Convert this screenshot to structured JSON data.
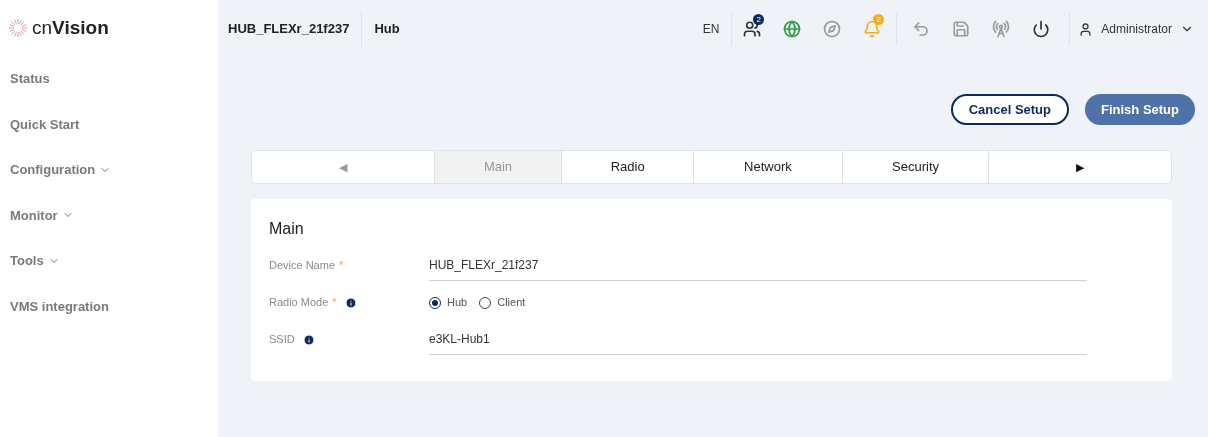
{
  "logo": {
    "text": "cn**Vision**"
  },
  "sidebar": {
    "items": [
      {
        "label": "Status",
        "expandable": false
      },
      {
        "label": "Quick Start",
        "expandable": false
      },
      {
        "label": "Configuration",
        "expandable": true
      },
      {
        "label": "Monitor",
        "expandable": true
      },
      {
        "label": "Tools",
        "expandable": true
      },
      {
        "label": "VMS integration",
        "expandable": false
      }
    ]
  },
  "header": {
    "device": "HUB_FLEXr_21f237",
    "mode": "Hub",
    "language": "EN",
    "icons": [
      {
        "kind": "users",
        "badge": "2",
        "color": "#333333"
      },
      {
        "kind": "globe",
        "color": "#2e9e45"
      },
      {
        "kind": "compass",
        "color": "#9a9a9a"
      },
      {
        "kind": "bell",
        "badge": "2",
        "color": "#f0ad1f"
      },
      {
        "kind": "undo",
        "color": "#9a9a9a"
      },
      {
        "kind": "save",
        "color": "#9a9a9a"
      },
      {
        "kind": "tower",
        "color": "#9a9a9a"
      },
      {
        "kind": "power",
        "color": "#333333"
      }
    ],
    "user": "Administrator"
  },
  "actions": [
    {
      "label": "Cancel Setup",
      "kind": "outline"
    },
    {
      "label": "Finish Setup",
      "kind": "primary"
    }
  ],
  "tabs": [
    {
      "kind": "prev",
      "label": "◀",
      "disabled": true
    },
    {
      "kind": "tab",
      "label": "Main",
      "selected": true
    },
    {
      "kind": "tab",
      "label": "Radio",
      "selected": false
    },
    {
      "kind": "tab",
      "label": "Network",
      "selected": false
    },
    {
      "kind": "tab",
      "label": "Security",
      "selected": false
    },
    {
      "kind": "next",
      "label": "▶",
      "disabled": false
    }
  ],
  "section": {
    "title": "Main",
    "fields": [
      {
        "kind": "text",
        "label": "Device Name",
        "required_mark": "*",
        "info": false,
        "value": "HUB_FLEXr_21f237"
      },
      {
        "kind": "radio",
        "label": "Radio Mode",
        "required_mark": "*",
        "info": true,
        "options": [
          {
            "label": "Hub",
            "selected": true
          },
          {
            "label": "Client",
            "selected": false
          }
        ]
      },
      {
        "kind": "text",
        "label": "SSID",
        "info": true,
        "value": "e3KL-Hub1"
      }
    ]
  }
}
